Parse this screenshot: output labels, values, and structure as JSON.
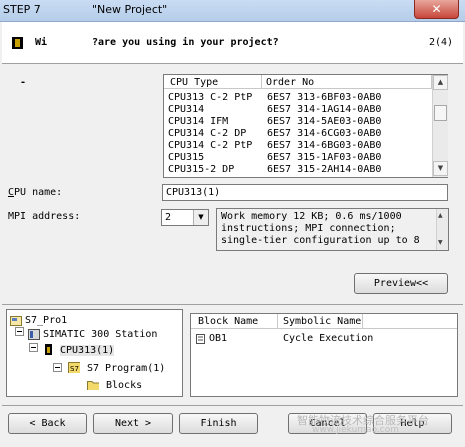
{
  "window": {
    "title_step": "STEP 7",
    "title_doc": "\"New Project\"",
    "close_symbol": "✕"
  },
  "header": {
    "text_prefix": "Wi",
    "text_main": "?are you using in your project?",
    "step": "2(4)"
  },
  "cpu_list": {
    "columns": [
      "CPU Type",
      "Order No"
    ],
    "rows": [
      {
        "type": "CPU313 C-2 PtP",
        "order": "6ES7 313-6BF03-0AB0"
      },
      {
        "type": "CPU314",
        "order": "6ES7 314-1AG14-0AB0"
      },
      {
        "type": "CPU314 IFM",
        "order": "6ES7 314-5AE03-0AB0"
      },
      {
        "type": "CPU314 C-2 DP",
        "order": "6ES7 314-6CG03-0AB0"
      },
      {
        "type": "CPU314 C-2 PtP",
        "order": "6ES7 314-6BG03-0AB0"
      },
      {
        "type": "CPU315",
        "order": "6ES7 315-1AF03-0AB0"
      },
      {
        "type": "CPU315-2 DP",
        "order": "6ES7 315-2AH14-0AB0"
      }
    ],
    "dash": "-"
  },
  "fields": {
    "cpu_name_label": "CPU name:",
    "cpu_name_value": "CPU313(1)",
    "mpi_label": "MPI address:",
    "mpi_value": "2",
    "description": [
      "Work memory 12 KB; 0.6 ms/1000",
      "instructions; MPI connection;",
      "single-tier configuration up to 8"
    ]
  },
  "preview_button": "Preview<<",
  "tree": {
    "root": "S7_Pro1",
    "station": "SIMATIC 300 Station",
    "cpu": "CPU313(1)",
    "program": "S7 Program(1)",
    "blocks": "Blocks"
  },
  "blocks_table": {
    "columns": [
      "Block Name",
      "Symbolic Name"
    ],
    "rows": [
      {
        "name": "OB1",
        "symbol": "Cycle Execution"
      }
    ]
  },
  "footer": {
    "back": "< Back",
    "next": "Next >",
    "finish": "Finish",
    "cancel": "Cancel",
    "help": "Help",
    "watermark_cn": "智能物流技术综合服务平台",
    "watermark_url": "www.jiekumao.com"
  }
}
